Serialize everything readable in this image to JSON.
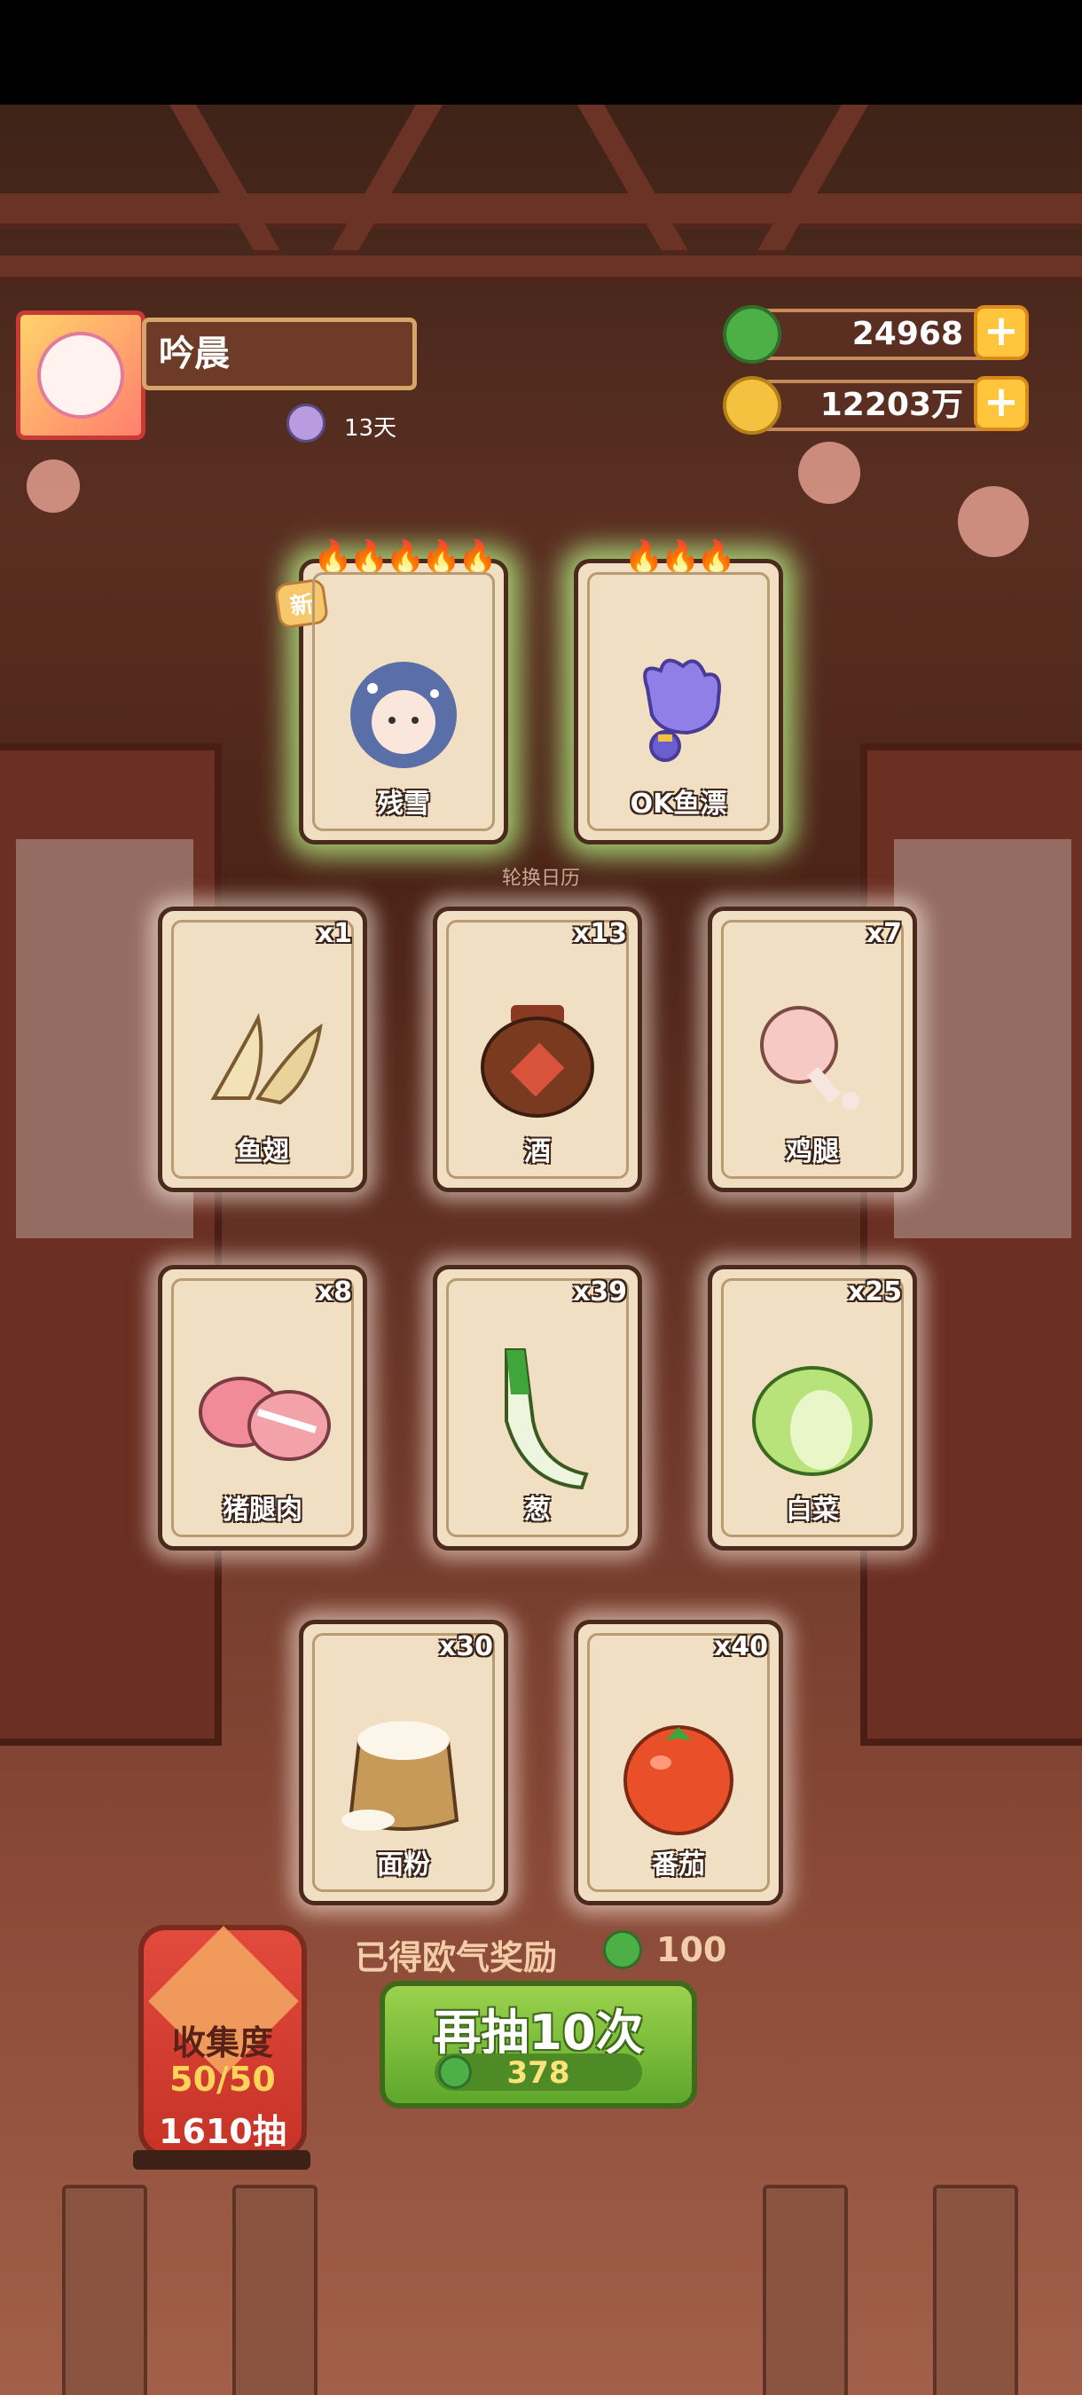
{
  "header": {
    "player_name": "吟晨",
    "days": "13天",
    "jade_amount": "24968",
    "coin_amount": "12203万",
    "plus_label": "+"
  },
  "featured_cards": [
    {
      "name": "残雪",
      "badge": "新",
      "flames": "🔥🔥🔥🔥🔥"
    },
    {
      "name": "OK鱼漂",
      "flames": "🔥🔥🔥"
    }
  ],
  "calendar_label": "轮换日历",
  "ingredients": [
    {
      "name": "鱼翅",
      "count": "x1"
    },
    {
      "name": "酒",
      "count": "x13"
    },
    {
      "name": "鸡腿",
      "count": "x7"
    },
    {
      "name": "猪腿肉",
      "count": "x8"
    },
    {
      "name": "葱",
      "count": "x39"
    },
    {
      "name": "白菜",
      "count": "x25"
    },
    {
      "name": "面粉",
      "count": "x30"
    },
    {
      "name": "番茄",
      "count": "x40"
    }
  ],
  "collection": {
    "title": "收集度",
    "progress": "50/50",
    "draws": "1610抽"
  },
  "reward": {
    "text": "已得欧气奖励",
    "amount": "100"
  },
  "draw_button": {
    "label": "再抽10次",
    "cost": "378"
  },
  "colors": {
    "jade": "#4cb047",
    "gold": "#ffc53d",
    "card_bg": "#f0dfc2",
    "button_green": "#7cbd3a"
  }
}
